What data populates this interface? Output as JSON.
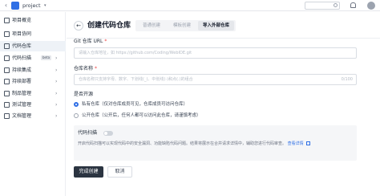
{
  "topbar": {
    "back_glyph": "‹",
    "project_label": "project",
    "caret_glyph": "▾",
    "icons": [
      "back-icon",
      "project-avatar",
      "search-icon",
      "bell-icon",
      "user-avatar"
    ]
  },
  "sidebar": {
    "items": [
      {
        "label": "项目概览",
        "icon": "overview-icon"
      },
      {
        "label": "项目协同",
        "icon": "collab-icon"
      },
      {
        "label": "代码仓库",
        "icon": "repo-icon",
        "active": true
      },
      {
        "label": "代码扫描",
        "icon": "scan-icon",
        "badge": "beta",
        "chevron": "›"
      },
      {
        "label": "持续集成",
        "icon": "ci-icon",
        "chevron": "›"
      },
      {
        "label": "持续部署",
        "icon": "cd-icon",
        "chevron": "›"
      },
      {
        "label": "制品管理",
        "icon": "artifact-icon",
        "chevron": "›"
      },
      {
        "label": "测试管理",
        "icon": "test-icon",
        "chevron": "›"
      },
      {
        "label": "文档管理",
        "icon": "doc-icon",
        "chevron": "›"
      }
    ]
  },
  "header": {
    "back_glyph": "←",
    "title": "创建代码仓库",
    "tabs": [
      {
        "label": "普通创建",
        "active": false
      },
      {
        "label": "模板创建",
        "active": false
      },
      {
        "label": "导入外部仓库",
        "active": true
      }
    ]
  },
  "form": {
    "git_url": {
      "label": "Git 仓库 URL",
      "required_mark": "*",
      "placeholder": "请输入仓库地址，如 https://github.com/Coding/WebIDE.git"
    },
    "repo_name": {
      "label": "仓库名称",
      "required_mark": "*",
      "placeholder": "仓库名称只支持字母、数字、下划线(_)、中划线(-)和点(.)的组合",
      "counter": "0/100"
    },
    "open_source": {
      "label": "是否开源",
      "options": [
        {
          "label": "私有仓库（仅对仓库成员可见，仓库成员可访问仓库）",
          "selected": true
        },
        {
          "label": "公开仓库（公开后，任何人都可以访问此仓库，请谨慎考虑）",
          "selected": false
        }
      ]
    },
    "code_scan": {
      "title": "代码扫描",
      "enabled": false,
      "description": "开启代码扫描可以实现代码中的安全漏洞、功能缺陷代码问题。结果将展示在合并请求详情中，辅助您进行代码审查。",
      "link": "查看详情"
    }
  },
  "actions": {
    "submit": "完成创建",
    "cancel": "取消"
  },
  "colors": {
    "accent": "#2f6fe5",
    "primary_button": "#2b3441",
    "required": "#ef4444"
  }
}
